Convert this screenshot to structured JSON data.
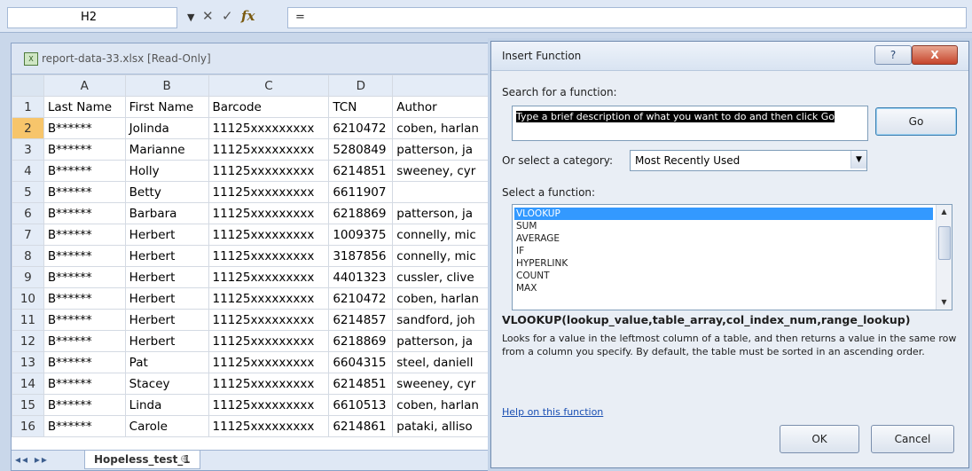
{
  "formula_bar": {
    "name_box": "H2",
    "formula": "="
  },
  "workbook": {
    "title": "report-data-33.xlsx  [Read-Only]",
    "columns": [
      "A",
      "B",
      "C",
      "D"
    ],
    "rows": [
      {
        "n": "1",
        "a": "Last Name",
        "b": "First Name",
        "c": "Barcode",
        "d": "TCN",
        "e": "Author"
      },
      {
        "n": "2",
        "a": "B******",
        "b": "Jolinda",
        "c": "11125xxxxxxxxx",
        "d": "6210472",
        "e": "coben, harlan"
      },
      {
        "n": "3",
        "a": "B******",
        "b": "Marianne",
        "c": "11125xxxxxxxxx",
        "d": "5280849",
        "e": "patterson, ja"
      },
      {
        "n": "4",
        "a": "B******",
        "b": "Holly",
        "c": "11125xxxxxxxxx",
        "d": "6214851",
        "e": "sweeney, cyr"
      },
      {
        "n": "5",
        "a": "B******",
        "b": "Betty",
        "c": "11125xxxxxxxxx",
        "d": "6611907",
        "e": ""
      },
      {
        "n": "6",
        "a": "B******",
        "b": "Barbara",
        "c": "11125xxxxxxxxx",
        "d": "6218869",
        "e": "patterson, ja"
      },
      {
        "n": "7",
        "a": "B******",
        "b": "Herbert",
        "c": "11125xxxxxxxxx",
        "d": "1009375",
        "e": "connelly, mic"
      },
      {
        "n": "8",
        "a": "B******",
        "b": "Herbert",
        "c": "11125xxxxxxxxx",
        "d": "3187856",
        "e": "connelly, mic"
      },
      {
        "n": "9",
        "a": "B******",
        "b": "Herbert",
        "c": "11125xxxxxxxxx",
        "d": "4401323",
        "e": "cussler, clive"
      },
      {
        "n": "10",
        "a": "B******",
        "b": "Herbert",
        "c": "11125xxxxxxxxx",
        "d": "6210472",
        "e": "coben, harlan"
      },
      {
        "n": "11",
        "a": "B******",
        "b": "Herbert",
        "c": "11125xxxxxxxxx",
        "d": "6214857",
        "e": "sandford, joh"
      },
      {
        "n": "12",
        "a": "B******",
        "b": "Herbert",
        "c": "11125xxxxxxxxx",
        "d": "6218869",
        "e": "patterson, ja"
      },
      {
        "n": "13",
        "a": "B******",
        "b": "Pat",
        "c": "11125xxxxxxxxx",
        "d": "6604315",
        "e": "steel, daniell"
      },
      {
        "n": "14",
        "a": "B******",
        "b": "Stacey",
        "c": "11125xxxxxxxxx",
        "d": "6214851",
        "e": "sweeney, cyr"
      },
      {
        "n": "15",
        "a": "B******",
        "b": "Linda",
        "c": "11125xxxxxxxxx",
        "d": "6610513",
        "e": "coben, harlan"
      },
      {
        "n": "16",
        "a": "B******",
        "b": "Carole",
        "c": "11125xxxxxxxxx",
        "d": "6214861",
        "e": "pataki, alliso"
      }
    ],
    "sheet_tab": "Hopeless_test_1"
  },
  "dialog": {
    "title": "Insert Function",
    "help_btn": "?",
    "close_btn": "X",
    "search_label": "Search for a function:",
    "search_value": "Type a brief description of what you want to do and then click Go",
    "go_btn": "Go",
    "category_label": "Or select a category:",
    "category_value": "Most Recently Used",
    "function_label": "Select a function:",
    "functions": [
      "VLOOKUP",
      "SUM",
      "AVERAGE",
      "IF",
      "HYPERLINK",
      "COUNT",
      "MAX"
    ],
    "signature": "VLOOKUP(lookup_value,table_array,col_index_num,range_lookup)",
    "description": "Looks for a value in the leftmost column of a table, and then returns a value in the same row from a column you specify. By default, the table must be sorted in an ascending order.",
    "help_link": "Help on this function",
    "ok_btn": "OK",
    "cancel_btn": "Cancel"
  }
}
